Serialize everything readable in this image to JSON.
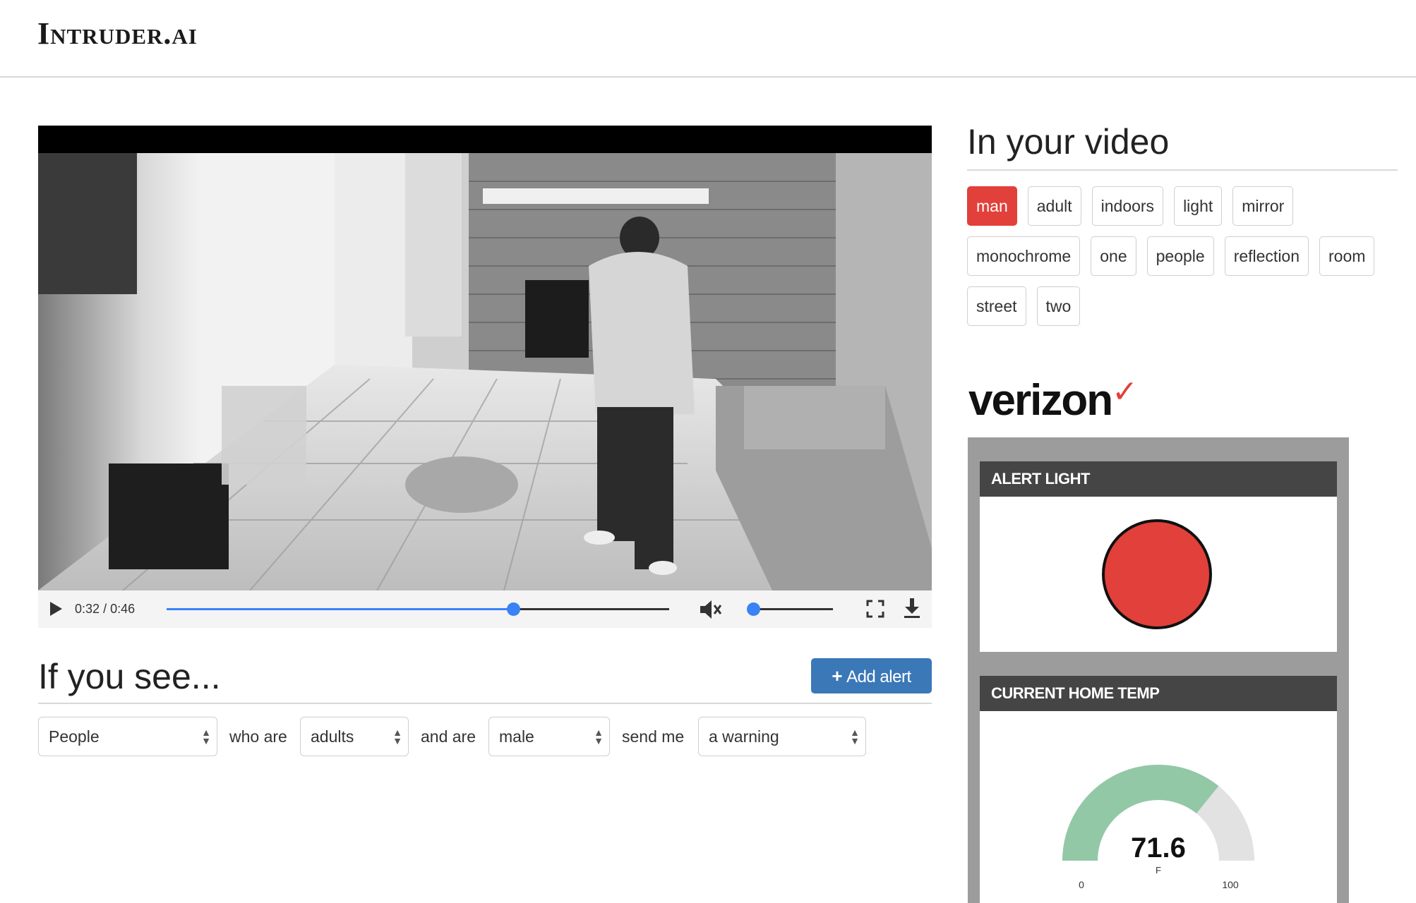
{
  "app": {
    "brand": "Intruder.ai"
  },
  "video": {
    "time_current": "0:32",
    "time_separator": "/",
    "time_total": "0:46",
    "progress": 0.69,
    "volume": 0.0
  },
  "tags_panel": {
    "title": "In your video",
    "tags": [
      {
        "label": "man",
        "active": true
      },
      {
        "label": "adult",
        "active": false
      },
      {
        "label": "indoors",
        "active": false
      },
      {
        "label": "light",
        "active": false
      },
      {
        "label": "mirror",
        "active": false
      },
      {
        "label": "monochrome",
        "active": false
      },
      {
        "label": "one",
        "active": false
      },
      {
        "label": "people",
        "active": false
      },
      {
        "label": "reflection",
        "active": false
      },
      {
        "label": "room",
        "active": false
      },
      {
        "label": "street",
        "active": false
      },
      {
        "label": "two",
        "active": false
      }
    ]
  },
  "sponsor": {
    "name": "verizon",
    "mark": "✓"
  },
  "widgets": {
    "alert_light": {
      "title": "ALERT LIGHT",
      "color": "#e2403a"
    },
    "home_temp": {
      "title": "CURRENT HOME TEMP",
      "value": "71.6",
      "unit": "F",
      "min": "0",
      "max": "100",
      "fraction": 0.716,
      "fill_color": "#93c8a6",
      "track_color": "#e2e2e2"
    }
  },
  "rule_builder": {
    "title": "If you see...",
    "add_button": "Add alert",
    "subject": "People",
    "text_who_are": "who are",
    "age": "adults",
    "text_and_are": "and are",
    "gender": "male",
    "text_send_me": "send me",
    "action": "a warning"
  }
}
